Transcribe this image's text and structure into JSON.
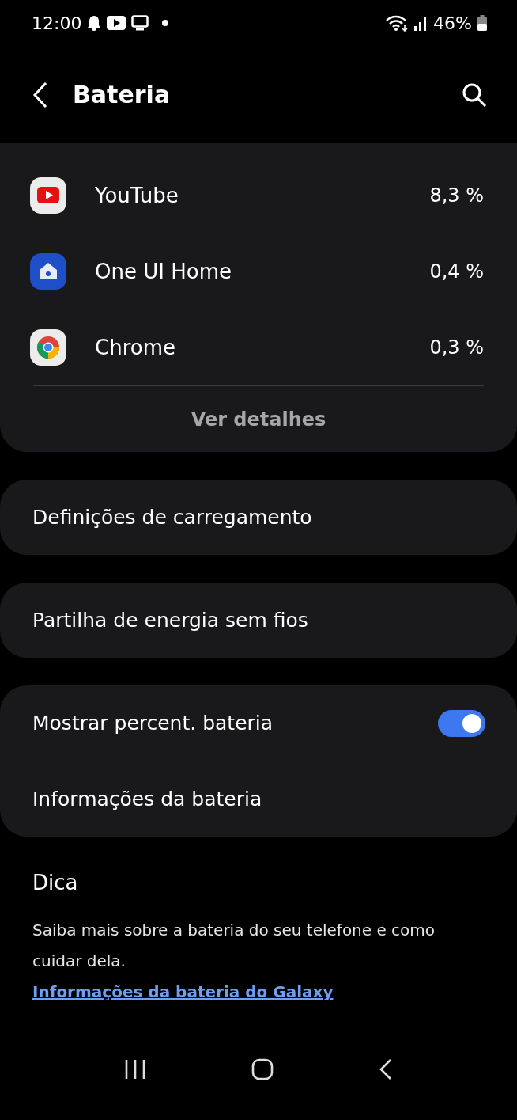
{
  "status_bar": {
    "time": "12:00",
    "battery_text": "46%"
  },
  "header": {
    "title": "Bateria"
  },
  "app_usage": {
    "apps": [
      {
        "name": "YouTube",
        "usage": "8,3 %",
        "kind": "youtube"
      },
      {
        "name": "One UI Home",
        "usage": "0,4 %",
        "kind": "home"
      },
      {
        "name": "Chrome",
        "usage": "0,3 %",
        "kind": "chrome"
      }
    ],
    "details_button": "Ver detalhes"
  },
  "settings_groups": [
    [
      {
        "label": "Definições de carregamento",
        "kind": "link"
      }
    ],
    [
      {
        "label": "Partilha de energia sem fios",
        "kind": "link"
      }
    ],
    [
      {
        "label": "Mostrar percent. bateria",
        "kind": "toggle",
        "on": true
      },
      {
        "label": "Informações da bateria",
        "kind": "link"
      }
    ]
  ],
  "tip": {
    "title": "Dica",
    "text": "Saiba mais sobre a bateria do seu telefone e como cuidar dela.",
    "link": "Informações da bateria do Galaxy"
  }
}
